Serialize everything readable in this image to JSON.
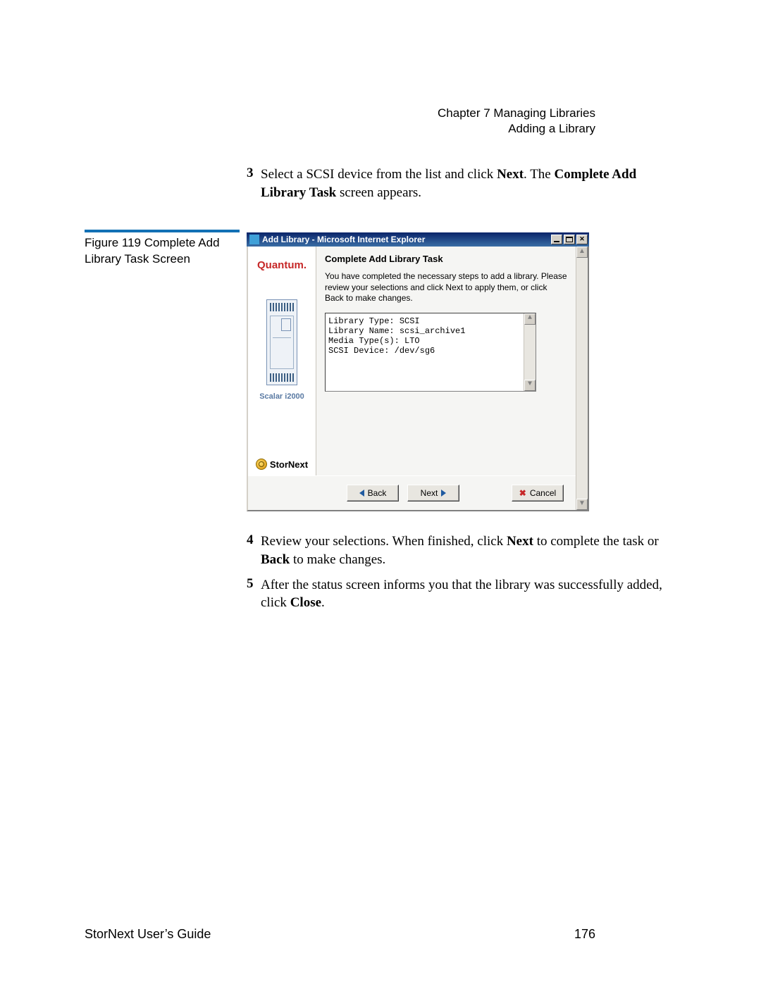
{
  "header": {
    "chapter": "Chapter 7  Managing Libraries",
    "section": "Adding a Library"
  },
  "steps": {
    "s3": {
      "num": "3",
      "part1": "Select a SCSI device from the list and click ",
      "bold1": "Next",
      "part2": ". The ",
      "bold2": "Complete Add Library Task",
      "part3": " screen appears."
    },
    "s4": {
      "num": "4",
      "part1": "Review your selections. When finished, click ",
      "bold1": "Next",
      "part2": " to complete the task or ",
      "bold2": "Back",
      "part3": " to make changes."
    },
    "s5": {
      "num": "5",
      "part1": "After the status screen informs you that the library was successfully added, click ",
      "bold1": "Close",
      "part2": "."
    }
  },
  "figure": {
    "caption": "Figure 119  Complete Add Library Task Screen"
  },
  "window": {
    "title": "Add Library - Microsoft Internet Explorer",
    "brand": "Quantum.",
    "device_label": "Scalar i2000",
    "product": "StorNext",
    "task_title": "Complete Add Library Task",
    "description": "You have completed the necessary steps to add a library. Please review your selections and click Next to apply them, or click Back to make changes.",
    "summary": "Library Type: SCSI\nLibrary Name: scsi_archive1\nMedia Type(s): LTO\nSCSI Device: /dev/sg6",
    "buttons": {
      "back": "Back",
      "next": "Next",
      "cancel": "Cancel"
    }
  },
  "footer": {
    "guide": "StorNext User’s Guide",
    "page": "176"
  }
}
